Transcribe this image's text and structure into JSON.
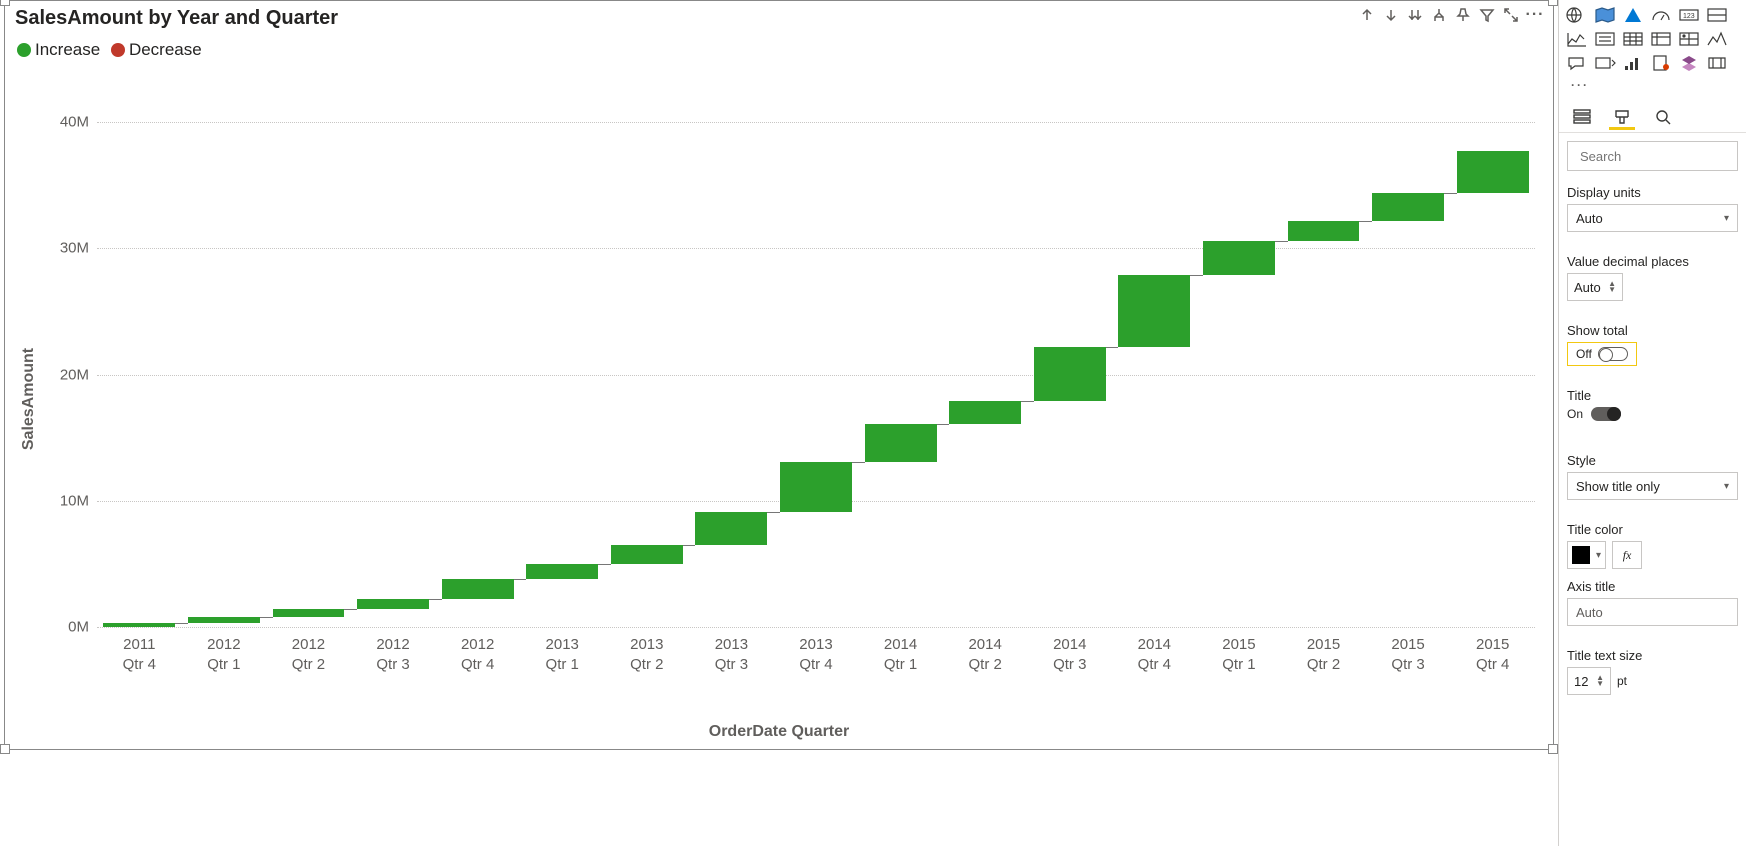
{
  "chart": {
    "title": "SalesAmount by Year and Quarter",
    "legend": {
      "increase": {
        "label": "Increase",
        "color": "#2ca02c"
      },
      "decrease": {
        "label": "Decrease",
        "color": "#c0392b"
      }
    },
    "y_axis_title": "SalesAmount",
    "x_axis_title": "OrderDate Quarter",
    "y_ticks": [
      "0M",
      "10M",
      "20M",
      "30M",
      "40M"
    ]
  },
  "chart_data": {
    "type": "bar",
    "subtype": "waterfall",
    "title": "SalesAmount by Year and Quarter",
    "xlabel": "OrderDate Quarter",
    "ylabel": "SalesAmount",
    "ylim": [
      0,
      42000000
    ],
    "y_unit": "M",
    "categories": [
      "2011 Qtr 4",
      "2012 Qtr 1",
      "2012 Qtr 2",
      "2012 Qtr 3",
      "2012 Qtr 4",
      "2013 Qtr 1",
      "2013 Qtr 2",
      "2013 Qtr 3",
      "2013 Qtr 4",
      "2014 Qtr 1",
      "2014 Qtr 2",
      "2014 Qtr 3",
      "2014 Qtr 4",
      "2015 Qtr 1",
      "2015 Qtr 2",
      "2015 Qtr 3",
      "2015 Qtr 4"
    ],
    "values": [
      300000,
      500000,
      600000,
      800000,
      1600000,
      1200000,
      1500000,
      2600000,
      4000000,
      3000000,
      1800000,
      4300000,
      5700000,
      2700000,
      1600000,
      2200000,
      3300000
    ],
    "cumulative": [
      300000,
      800000,
      1400000,
      2200000,
      3800000,
      5000000,
      6500000,
      9100000,
      13100000,
      16100000,
      17900000,
      22200000,
      27900000,
      30600000,
      32200000,
      34400000,
      37700000
    ],
    "series": [
      {
        "name": "Increase",
        "color": "#2ca02c"
      },
      {
        "name": "Decrease",
        "color": "#c0392b"
      }
    ]
  },
  "header_icons": {
    "drill_up": "Drill up",
    "drill_down": "Drill down",
    "expand": "Expand all",
    "hierarchy": "Go to next level",
    "pin": "Pin",
    "filter": "Filter",
    "focus": "Focus mode",
    "more": "More options"
  },
  "format_pane": {
    "search_placeholder": "Search",
    "display_units": {
      "label": "Display units",
      "value": "Auto"
    },
    "value_decimal_places": {
      "label": "Value decimal places",
      "value": "Auto"
    },
    "show_total": {
      "label": "Show total",
      "state_label": "Off",
      "on": false
    },
    "title_toggle": {
      "label": "Title",
      "state_label": "On",
      "on": true
    },
    "style": {
      "label": "Style",
      "value": "Show title only"
    },
    "title_color": {
      "label": "Title color",
      "value": "#000000"
    },
    "axis_title": {
      "label": "Axis title",
      "value": "Auto"
    },
    "title_text_size": {
      "label": "Title text size",
      "value": "12",
      "unit": "pt"
    },
    "fx": "fx"
  }
}
